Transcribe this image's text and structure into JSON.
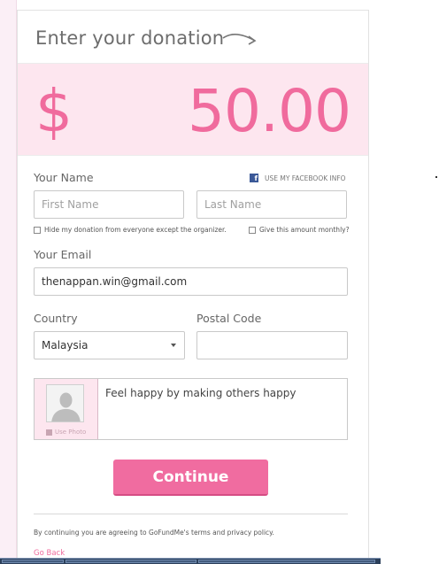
{
  "header": {
    "title": "Enter your donation"
  },
  "amount": {
    "currency": "$",
    "value": "50.00"
  },
  "name_section": {
    "label": "Your Name",
    "facebook_link": "USE MY FACEBOOK INFO",
    "first_name_placeholder": "First Name",
    "last_name_placeholder": "Last Name",
    "hide_donation_label": "Hide my donation from everyone except the organizer.",
    "monthly_label": "Give this amount monthly?"
  },
  "email_section": {
    "label": "Your Email",
    "value": "thenappan.win@gmail.com"
  },
  "country_section": {
    "label": "Country",
    "selected": "Malaysia"
  },
  "postal_section": {
    "label": "Postal Code",
    "value": ""
  },
  "comment": {
    "use_photo_label": "Use Photo",
    "text": "Feel happy by making others happy"
  },
  "continue_label": "Continue",
  "terms_text": "By continuing you are agreeing to GoFundMe's terms and privacy policy.",
  "go_back_label": "Go Back",
  "colors": {
    "accent_pink": "#f06b9d",
    "band_pink": "#fde6ef",
    "facebook_blue": "#3b5998"
  }
}
